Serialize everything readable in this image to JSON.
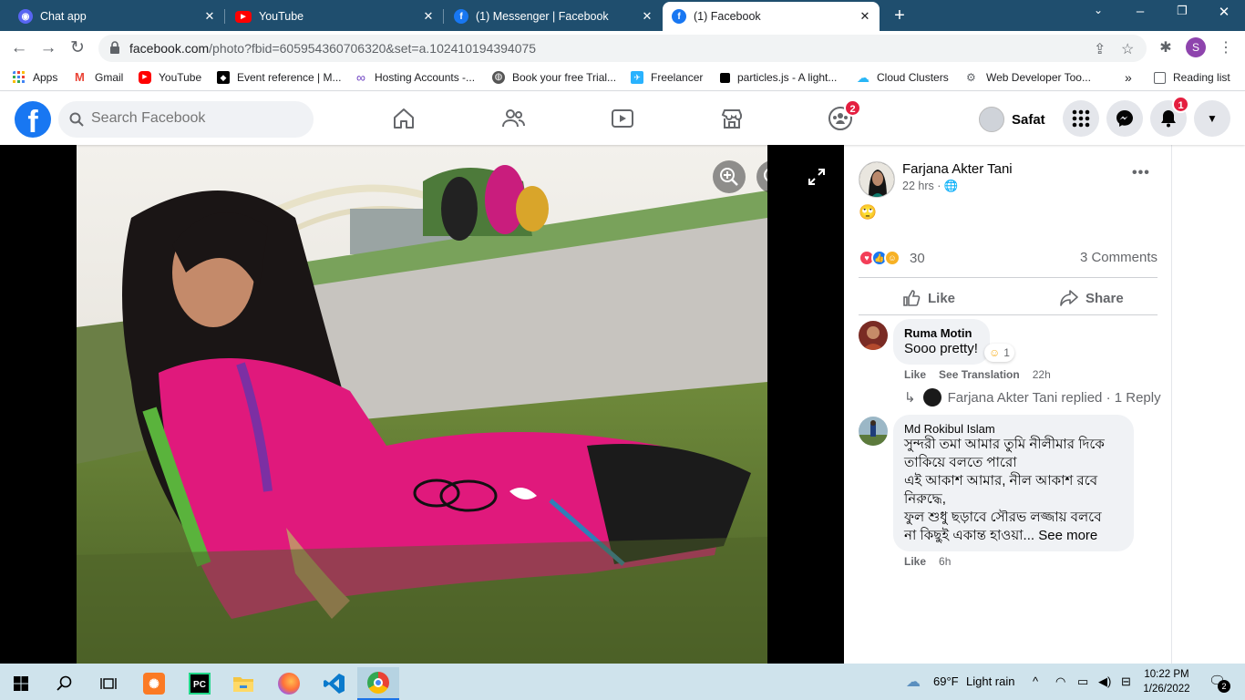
{
  "tabs": [
    {
      "title": "Chat app",
      "color": "#5865f2"
    },
    {
      "title": "YouTube",
      "color": "#ff0000"
    },
    {
      "title": "(1) Messenger | Facebook",
      "color": "#1877f2"
    },
    {
      "title": "(1) Facebook",
      "color": "#1877f2",
      "active": true
    }
  ],
  "address": {
    "host": "facebook.com",
    "path": "/photo?fbid=605954360706320&set=a.102410194394075"
  },
  "bookmarks": [
    {
      "label": "Apps",
      "icon": "apps-grid-icon"
    },
    {
      "label": "Gmail",
      "icon": "gmail-icon"
    },
    {
      "label": "YouTube",
      "icon": "youtube-icon"
    },
    {
      "label": "Event reference | M...",
      "icon": "mdn-icon"
    },
    {
      "label": "Hosting Accounts -...",
      "icon": "infinity-icon"
    },
    {
      "label": "Book your free Trial...",
      "icon": "globe-icon"
    },
    {
      "label": "Freelancer",
      "icon": "freelancer-icon"
    },
    {
      "label": "particles.js - A light...",
      "icon": "particles-icon"
    },
    {
      "label": "Cloud Clusters",
      "icon": "cloud-icon"
    },
    {
      "label": "Web Developer Too...",
      "icon": "webdev-icon"
    }
  ],
  "reading_list": "Reading list",
  "fb": {
    "search_placeholder": "Search Facebook",
    "groups_badge": "2",
    "notif_badge": "1",
    "user": "Safat",
    "profile_initial": "S"
  },
  "post": {
    "author": "Farjana Akter Tani",
    "time": "22 hrs · ",
    "emoji": "🙄",
    "reactions": "30",
    "comments": "3 Comments",
    "like": "Like",
    "share": "Share"
  },
  "comments": [
    {
      "name": "Ruma Motin",
      "text": "Sooo pretty!",
      "reaction_count": "1",
      "like": "Like",
      "translate": "See Translation",
      "time": "22h"
    },
    {
      "name": "Md Rokibul Islam",
      "text1": "সুন্দরী তমা আমার তুমি নীলীমার দিকে",
      "text2": "তাকিয়ে বলতে পারো",
      "text3": "এই আকাশ আমার, নীল আকাশ রবে",
      "text4": "নিরুদ্ধে,",
      "text5": "ফুল শুধু ছড়াবে সৌরভ লজ্জায় বলবে",
      "text6": "না কিছুই একান্ত হাওয়া...",
      "see_more": "See more",
      "like": "Like",
      "time": "6h"
    }
  ],
  "reply": {
    "text": "Farjana Akter Tani replied · 1 Reply"
  },
  "taskbar": {
    "weather_temp": "69°F",
    "weather_desc": "Light rain",
    "time": "10:22 PM",
    "date": "1/26/2022",
    "notif_count": "2"
  }
}
